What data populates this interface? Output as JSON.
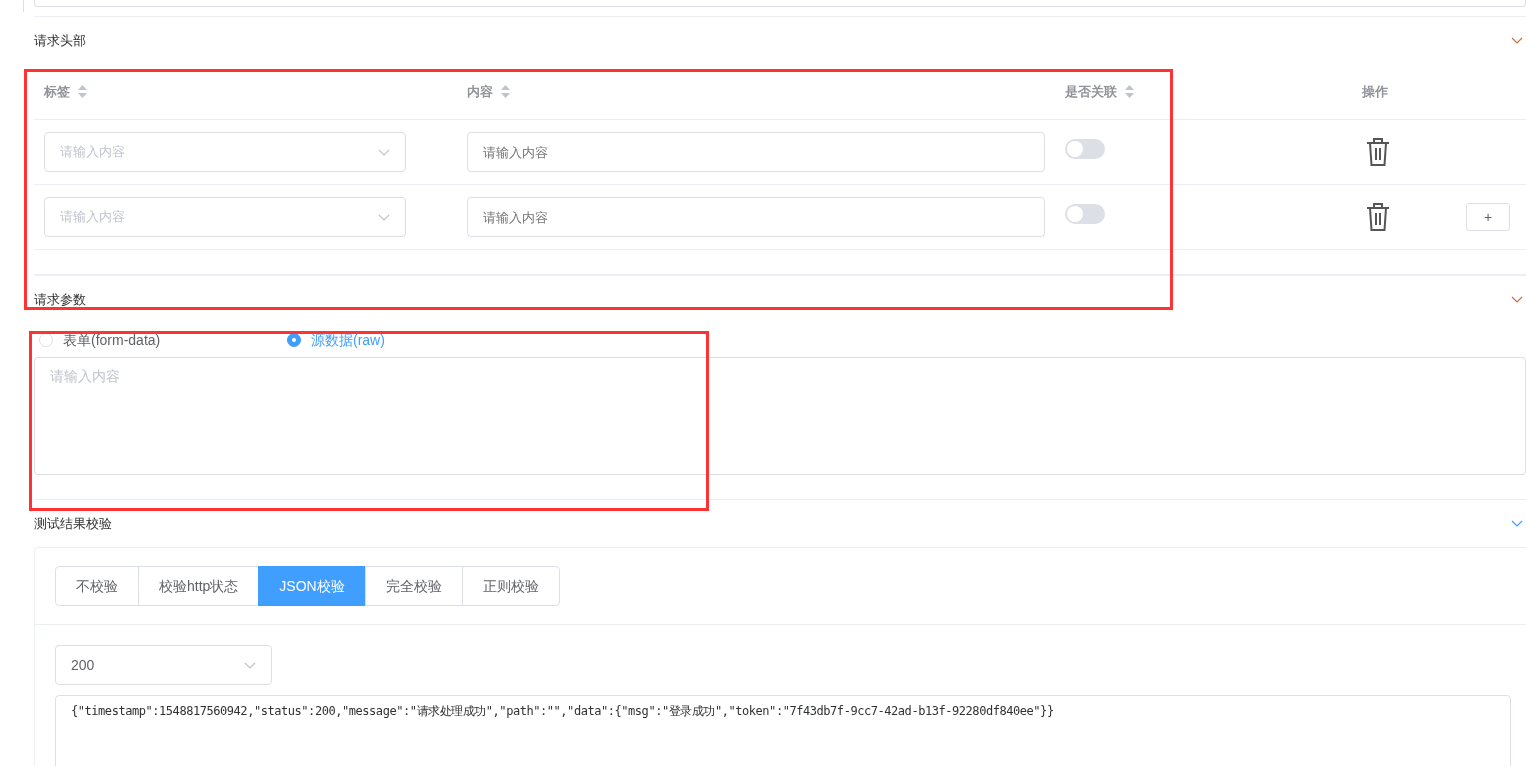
{
  "sections": [
    {
      "kind": "headers",
      "title": "请求头部",
      "table": {
        "columns": [
          {
            "label": "标签",
            "sortable": true
          },
          {
            "label": "内容",
            "sortable": true
          },
          {
            "label": "是否关联",
            "sortable": true
          },
          {
            "label": "操作",
            "sortable": false
          }
        ],
        "rows": [
          {
            "label_placeholder": "请输入内容",
            "content_placeholder": "请输入内容",
            "linked": false
          },
          {
            "label_placeholder": "请输入内容",
            "content_placeholder": "请输入内容",
            "linked": false,
            "add_label": "+"
          }
        ]
      }
    },
    {
      "kind": "params",
      "title": "请求参数",
      "radios": [
        {
          "label": "表单(form-data)",
          "selected": false
        },
        {
          "label": "源数据(raw)",
          "selected": true
        }
      ],
      "body_placeholder": "请输入内容"
    },
    {
      "kind": "validation",
      "title": "测试结果校验",
      "tabs": [
        {
          "label": "不校验",
          "selected": false
        },
        {
          "label": "校验http状态",
          "selected": false
        },
        {
          "label": "JSON校验",
          "selected": true
        },
        {
          "label": "完全校验",
          "selected": false
        },
        {
          "label": "正则校验",
          "selected": false
        }
      ],
      "status_select": "200",
      "expected_body": "{\"timestamp\":1548817560942,\"status\":200,\"message\":\"请求处理成功\",\"path\":\"\",\"data\":{\"msg\":\"登录成功\",\"token\":\"7f43db7f-9cc7-42ad-b13f-92280df840ee\"}}"
    }
  ],
  "highlight_frames": [
    {
      "color": "#ff3333"
    },
    {
      "color": "#ff3333"
    }
  ]
}
